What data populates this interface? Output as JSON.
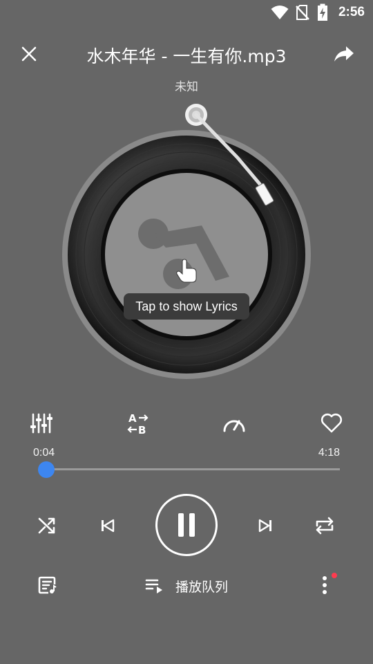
{
  "status_bar": {
    "time": "2:56",
    "icons": [
      "wifi-icon",
      "no-sim-icon",
      "battery-charging-icon"
    ]
  },
  "header": {
    "title": "水木年华 - 一生有你.mp3",
    "artist": "未知",
    "close_icon": "close-icon",
    "share_icon": "share-icon"
  },
  "disc": {
    "tooltip": "Tap to show Lyrics",
    "album_art_icon": "music-note-icon"
  },
  "controls_row1": [
    "equalizer-icon",
    "ab-repeat-icon",
    "speed-icon",
    "favorite-icon"
  ],
  "progress": {
    "current_time": "0:04",
    "total_time": "4:18",
    "fraction": 0.016
  },
  "playback": [
    "shuffle-icon",
    "previous-icon",
    "pause-icon",
    "next-icon",
    "repeat-icon"
  ],
  "bottom": {
    "queue_label": "播放队列",
    "lyrics_icon": "lyrics-icon",
    "more_icon": "more-vertical-icon"
  },
  "colors": {
    "background": "#666666",
    "accent": "#3d86f0",
    "badge": "#ff3b4f"
  }
}
